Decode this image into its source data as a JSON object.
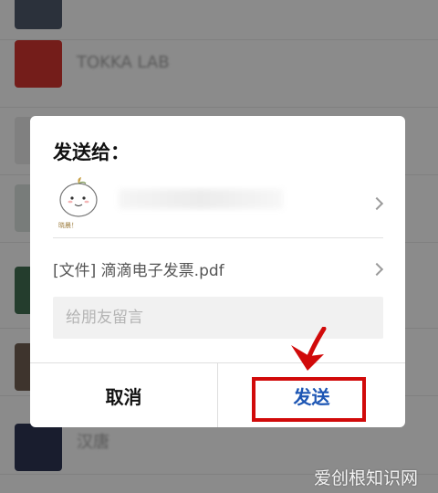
{
  "background": {
    "rows": [
      {
        "name": ""
      },
      {
        "name": "TOKKA LAB"
      },
      {
        "name": ""
      },
      {
        "name": ""
      },
      {
        "name": ""
      },
      {
        "name": ""
      },
      {
        "name": "汉唐"
      }
    ]
  },
  "dialog": {
    "title": "发送给：",
    "file_label": "[文件] 滴滴电子发票.pdf",
    "note_placeholder": "给朋友留言",
    "cancel_label": "取消",
    "send_label": "发送",
    "avatar_caption": "晓晨！"
  },
  "annotation": {
    "highlight_color": "#d10a0a"
  },
  "watermark": "爱创根知识网"
}
